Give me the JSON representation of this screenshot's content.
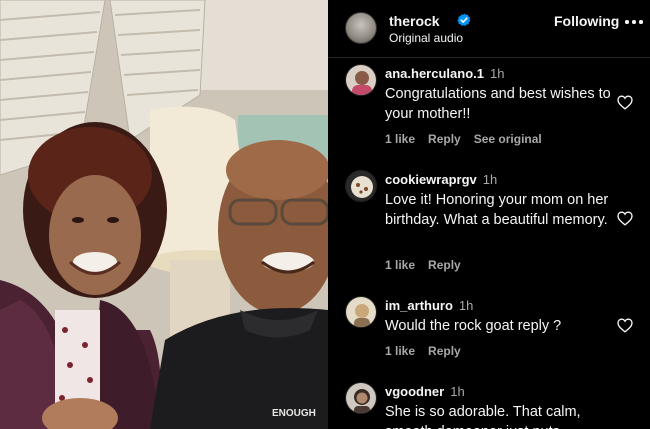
{
  "post": {
    "username": "therock",
    "audio": "Original audio",
    "follow_label": "Following",
    "photo_shirt_text": "ENOUGH"
  },
  "comments": [
    {
      "username": "ana.herculano.1",
      "time": "1h",
      "text": "Congratulations and best wishes to your mother!!",
      "likes": "1 like",
      "reply": "Reply",
      "extra": "See original"
    },
    {
      "username": "cookiewraprgv",
      "time": "1h",
      "text": "Love it! Honoring your mom on her birthday. What a beautiful memory.",
      "likes": "1 like",
      "reply": "Reply"
    },
    {
      "username": "im_arthuro",
      "time": "1h",
      "text": "Would the rock goat reply ?",
      "likes": "1 like",
      "reply": "Reply"
    },
    {
      "username": "vgoodner",
      "time": "1h",
      "text": "She is so adorable. That calm, smooth demeanor just puts"
    }
  ],
  "icons": {
    "verified": "verified-badge-icon",
    "more": "more-options-icon",
    "like": "heart-icon"
  },
  "colors": {
    "background": "#000000",
    "text": "#f5f5f5",
    "secondary": "#a8a8a8",
    "verified": "#0095f6"
  }
}
